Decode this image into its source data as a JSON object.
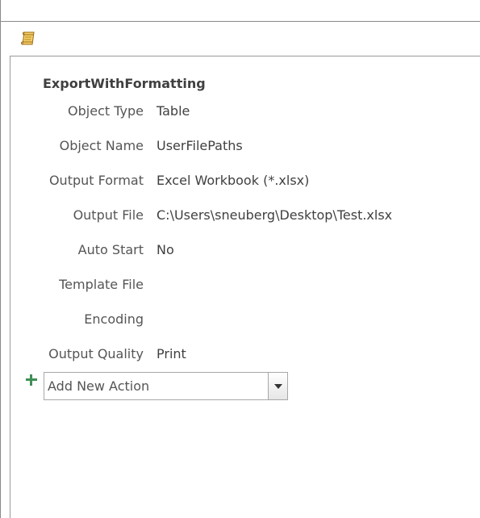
{
  "macro": {
    "icon": "macro-scroll-icon",
    "action_name": "ExportWithFormatting",
    "arguments": [
      {
        "label": "Object Type",
        "value": "Table"
      },
      {
        "label": "Object Name",
        "value": "UserFilePaths"
      },
      {
        "label": "Output Format",
        "value": "Excel Workbook (*.xlsx)"
      },
      {
        "label": "Output File",
        "value": "C:\\Users\\sneuberg\\Desktop\\Test.xlsx"
      },
      {
        "label": "Auto Start",
        "value": "No"
      },
      {
        "label": "Template File",
        "value": ""
      },
      {
        "label": "Encoding",
        "value": ""
      },
      {
        "label": "Output Quality",
        "value": "Print"
      }
    ],
    "add_action": {
      "icon": "plus-icon",
      "placeholder": "Add New Action"
    }
  },
  "colors": {
    "plus_icon": "#3f8f55",
    "icon_gold": "#d9a621"
  }
}
